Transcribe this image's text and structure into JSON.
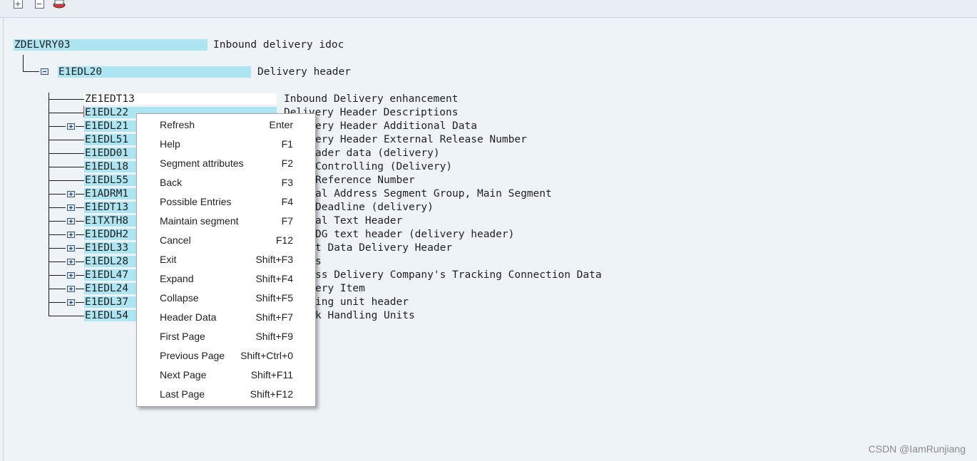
{
  "toolbar": {
    "icons": [
      "expand-subtree-icon",
      "collapse-subtree-icon",
      "display-segment-icon"
    ]
  },
  "tree": {
    "root": {
      "name": "ZDELVRY03",
      "desc": "Inbound delivery idoc"
    },
    "header": {
      "name": "E1EDL20",
      "desc": "Delivery header"
    },
    "children": [
      {
        "name": "ZE1EDT13",
        "desc": "Inbound Delivery enhancement",
        "expandable": false
      },
      {
        "name": "E1EDL22",
        "desc": "Delivery Header Descriptions",
        "expandable": false
      },
      {
        "name": "E1EDL21",
        "desc": "ery Header Additional Data",
        "expandable": true
      },
      {
        "name": "E1EDL51",
        "desc": "ery Header External Release Number",
        "expandable": false
      },
      {
        "name": "E1EDD01",
        "desc": "ader data (delivery)",
        "expandable": false
      },
      {
        "name": "E1EDL18",
        "desc": "Controlling (Delivery)",
        "expandable": false
      },
      {
        "name": "E1EDL55",
        "desc": "Reference Number",
        "expandable": false
      },
      {
        "name": "E1ADRM1",
        "desc": "al Address Segment Group, Main Segment",
        "expandable": true
      },
      {
        "name": "E1EDT13",
        "desc": "Deadline (delivery)",
        "expandable": true
      },
      {
        "name": "E1TXTH8",
        "desc": "al Text Header",
        "expandable": true
      },
      {
        "name": "E1EDDH2",
        "desc": "DG text header (delivery header)",
        "expandable": true
      },
      {
        "name": "E1EDL33",
        "desc": "t Data Delivery Header",
        "expandable": true
      },
      {
        "name": "E1EDL28",
        "desc": "s",
        "expandable": true
      },
      {
        "name": "E1EDL47",
        "desc": "ss Delivery Company's Tracking Connection Data",
        "expandable": true
      },
      {
        "name": "E1EDL24",
        "desc": "ery Item",
        "expandable": true
      },
      {
        "name": "E1EDL37",
        "desc": "ing unit header",
        "expandable": true
      },
      {
        "name": "E1EDL54",
        "desc": "k Handling Units",
        "expandable": false
      }
    ]
  },
  "context_menu": {
    "items": [
      {
        "label": "Refresh",
        "key": "Enter"
      },
      {
        "label": "Help",
        "key": "F1"
      },
      {
        "label": "Segment attributes",
        "key": "F2"
      },
      {
        "label": "Back",
        "key": "F3"
      },
      {
        "label": "Possible Entries",
        "key": "F4"
      },
      {
        "label": "Maintain segment",
        "key": "F7"
      },
      {
        "label": "Cancel",
        "key": "F12"
      },
      {
        "label": "Exit",
        "key": "Shift+F3"
      },
      {
        "label": "Expand",
        "key": "Shift+F4"
      },
      {
        "label": "Collapse",
        "key": "Shift+F5"
      },
      {
        "label": "Header Data",
        "key": "Shift+F7"
      },
      {
        "label": "First Page",
        "key": "Shift+F9"
      },
      {
        "label": "Previous Page",
        "key": "Shift+Ctrl+0"
      },
      {
        "label": "Next Page",
        "key": "Shift+F11"
      },
      {
        "label": "Last Page",
        "key": "Shift+F12"
      }
    ]
  },
  "watermark": "CSDN @IamRunjiang",
  "colors": {
    "highlight_cyan": "#ade6f2",
    "background": "#eef3f8"
  }
}
